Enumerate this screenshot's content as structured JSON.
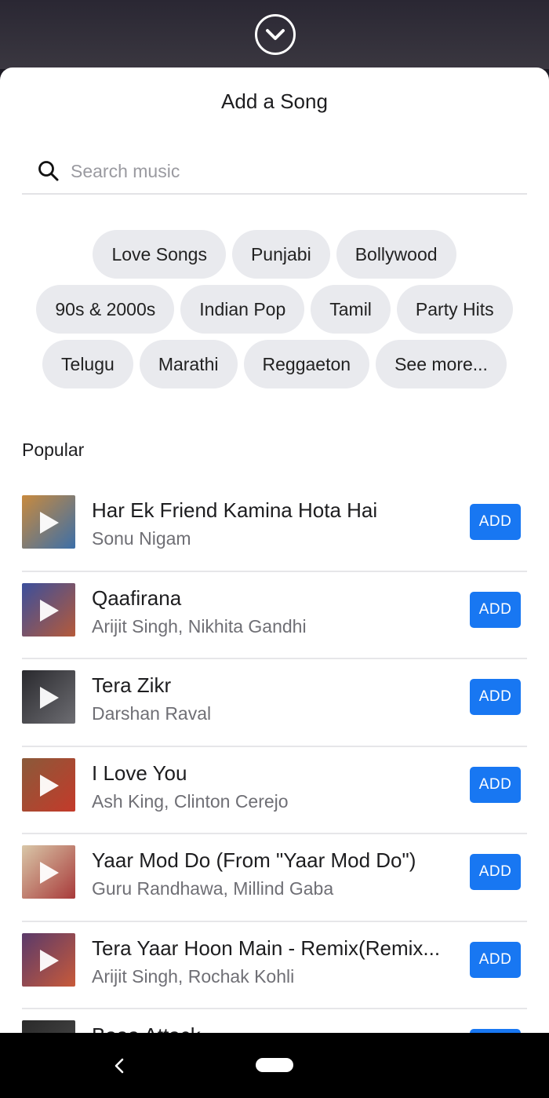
{
  "header": {
    "collapse_icon": "chevron-down-circle-icon"
  },
  "sheet": {
    "title": "Add a Song"
  },
  "search": {
    "placeholder": "Search music",
    "icon": "search-icon"
  },
  "genres": [
    [
      "Love Songs",
      "Punjabi",
      "Bollywood"
    ],
    [
      "90s & 2000s",
      "Indian Pop",
      "Tamil",
      "Party Hits"
    ],
    [
      "Telugu",
      "Marathi",
      "Reggaeton",
      "See more..."
    ]
  ],
  "popular": {
    "label": "Popular",
    "add_label": "ADD",
    "songs": [
      {
        "title": "Har Ek Friend Kamina Hota Hai",
        "artist": "Sonu Nigam",
        "thumb_colors": [
          "#c88a3e",
          "#3c6fa8"
        ]
      },
      {
        "title": "Qaafirana",
        "artist": "Arijit Singh, Nikhita Gandhi",
        "thumb_colors": [
          "#3b4f9c",
          "#b55a3a"
        ]
      },
      {
        "title": "Tera Zikr",
        "artist": "Darshan Raval",
        "thumb_colors": [
          "#2a2a2e",
          "#6d6d72"
        ]
      },
      {
        "title": "I Love You",
        "artist": "Ash King, Clinton Cerejo",
        "thumb_colors": [
          "#8a5a3a",
          "#c43a2a"
        ]
      },
      {
        "title": "Yaar Mod Do (From \"Yaar Mod Do\")",
        "artist": "Guru Randhawa, Millind Gaba",
        "thumb_colors": [
          "#d9c7a8",
          "#a83a3a"
        ]
      },
      {
        "title": "Tera Yaar Hoon Main - Remix(Remix...",
        "artist": "Arijit Singh, Rochak Kohli",
        "thumb_colors": [
          "#5a3a6a",
          "#c85a3a"
        ]
      },
      {
        "title": "Baaa Attack",
        "artist": "",
        "thumb_colors": [
          "#2a2a2a",
          "#4a4a4a"
        ]
      }
    ]
  },
  "colors": {
    "accent": "#1877f2",
    "chip_bg": "#e9eaee"
  },
  "nav": {
    "back_icon": "back-chevron-icon",
    "home_icon": "home-pill-icon"
  }
}
